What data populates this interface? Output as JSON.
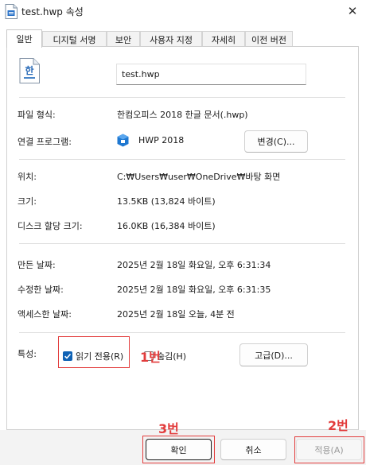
{
  "window": {
    "title": "test.hwp 속성",
    "close_glyph": "✕"
  },
  "tabs": [
    {
      "label": "일반"
    },
    {
      "label": "디지털 서명"
    },
    {
      "label": "보안"
    },
    {
      "label": "사용자 지정"
    },
    {
      "label": "자세히"
    },
    {
      "label": "이전 버전"
    }
  ],
  "general": {
    "doc_icon_glyph": "한",
    "filename": "test.hwp",
    "file_type_label": "파일 형식:",
    "file_type_value": "한컴오피스 2018 한글 문서(.hwp)",
    "open_with_label": "연결 프로그램:",
    "open_with_value": "HWP 2018",
    "change_button": "변경(C)...",
    "location_label": "위치:",
    "location_value": "C:₩Users₩user₩OneDrive₩바탕 화면",
    "size_label": "크기:",
    "size_value": "13.5KB (13,824 바이트)",
    "disk_size_label": "디스크 할당 크기:",
    "disk_size_value": "16.0KB (16,384 바이트)",
    "created_label": "만든 날짜:",
    "created_value": "2025년 2월 18일 화요일, 오후 6:31:34",
    "modified_label": "수정한 날짜:",
    "modified_value": "2025년 2월 18일 화요일, 오후 6:31:35",
    "accessed_label": "액세스한 날짜:",
    "accessed_value": "2025년 2월 18일 오늘, 4분 전",
    "attributes_label": "특성:",
    "readonly_label": "읽기 전용(R)",
    "hidden_label": "숨김(H)",
    "advanced_button": "고급(D)..."
  },
  "footer": {
    "ok": "확인",
    "cancel": "취소",
    "apply": "적용(A)"
  },
  "annotations": {
    "a1": "1번",
    "a2": "2번",
    "a3": "3번"
  },
  "colors": {
    "accent": "#0f62b5",
    "annotation": "#e23c3c"
  }
}
